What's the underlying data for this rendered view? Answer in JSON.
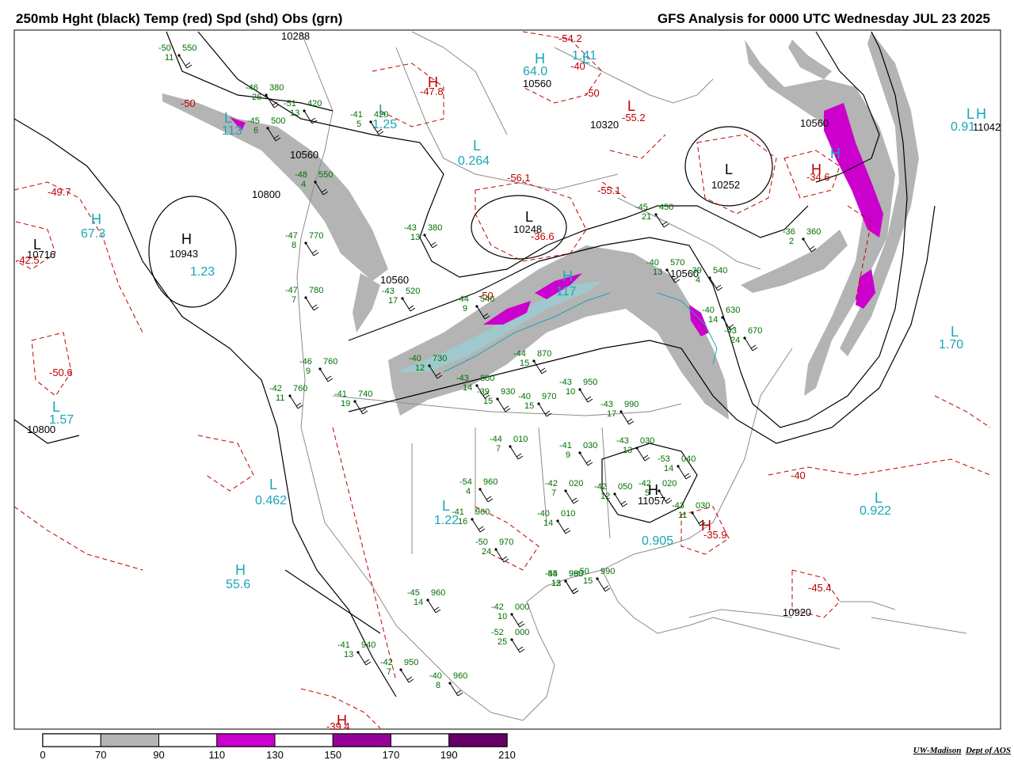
{
  "title_left": "250mb Hght (black) Temp (red) Spd (shd) Obs (grn)",
  "title_right": "GFS Analysis for 0000 UTC Wednesday  JUL 23 2025",
  "credit_org": "UW-Madison",
  "credit_dept": "Dept of AOS",
  "colors": {
    "height": "#000000",
    "temp": "#c00000",
    "obs": "#007000",
    "divergence": "#1aa6b7",
    "jet_70": "#b4b4b4",
    "jet_110": "#cc00cc",
    "jet_150": "#990099",
    "jet_190": "#660066",
    "geography": "#8c8c8c"
  },
  "colorbar": {
    "labels": [
      "0",
      "70",
      "90",
      "110",
      "130",
      "150",
      "170",
      "190",
      "210"
    ],
    "fills": [
      "#ffffff",
      "#b4b4b4",
      "#ffffff",
      "#cc00cc",
      "#ffffff",
      "#990099",
      "#ffffff",
      "#660066"
    ]
  },
  "height_labels": [
    "10800",
    "10943",
    "10716",
    "10800",
    "10560",
    "10560",
    "10320",
    "10248",
    "10560",
    "10252",
    "10560",
    "11042",
    "11057",
    "10920",
    "10288",
    "10560"
  ],
  "temp_labels": [
    "-49.7",
    "-50.6",
    "-50",
    "-47.8",
    "-50",
    "-55.2",
    "-56.1",
    "-55.1",
    "-36.6",
    "-54.2",
    "-40",
    "-34.6",
    "-40",
    "-45.4",
    "-39.4",
    "-35.9",
    "-50",
    "-42.5"
  ],
  "div_labels": [
    "67.3",
    "1.23",
    "1.57",
    "55.6",
    "0.462",
    "1.22",
    "0.905",
    "0.922",
    "1.70",
    "0.264",
    "1.25",
    "64.0",
    "1.41",
    "0.91",
    "113",
    "117"
  ],
  "pressure_centers": [
    "H",
    "H",
    "L",
    "L",
    "H",
    "L",
    "L",
    "H",
    "L",
    "L",
    "H",
    "H",
    "L",
    "L",
    "H",
    "L",
    "H",
    "L",
    "H",
    "L",
    "H",
    "H",
    "L",
    "H",
    "L",
    "H"
  ],
  "obs_temp": [
    "-50",
    "-46",
    "-51",
    "-45",
    "-48",
    "-47",
    "-47",
    "-46",
    "-42",
    "-41",
    "-40",
    "-43",
    "-44",
    "-39",
    "-40",
    "-41",
    "-43",
    "-43",
    "-44",
    "-42",
    "-41",
    "-42",
    "-43",
    "-53",
    "-54",
    "-55",
    "-52",
    "-50",
    "-41",
    "-42",
    "-40",
    "-40",
    "-50",
    "-42",
    "-43",
    "-45",
    "-42",
    "-44",
    "-43",
    "-43",
    "-45",
    "-41",
    "-44",
    "-40",
    "-39",
    "-36",
    "-40",
    "-43"
  ],
  "obs_hght": [
    "550",
    "380",
    "420",
    "500",
    "550",
    "770",
    "780",
    "760",
    "760",
    "740",
    "730",
    "880",
    "870",
    "930",
    "970",
    "960",
    "950",
    "990",
    "010",
    "020",
    "030",
    "050",
    "030",
    "040",
    "960",
    "980",
    "000",
    "970",
    "940",
    "950",
    "960",
    "010",
    "990",
    "020",
    "030",
    "960",
    "000",
    "990",
    "520",
    "380",
    "450",
    "420",
    "540",
    "570",
    "540",
    "360",
    "630",
    "670"
  ],
  "obs_wind": [
    "11",
    "26",
    "13",
    "6",
    "4",
    "8",
    "7",
    "9",
    "11",
    "19",
    "12",
    "14",
    "15",
    "15",
    "15",
    "16",
    "10",
    "17",
    "7",
    "7",
    "9",
    "12",
    "13",
    "14",
    "4",
    "12",
    "25",
    "24",
    "13",
    "7",
    "8",
    "14",
    "15",
    "5",
    "11",
    "14",
    "10",
    "13",
    "17",
    "13",
    "21",
    "5",
    "9",
    "13",
    "4",
    "2",
    "14",
    "24"
  ]
}
